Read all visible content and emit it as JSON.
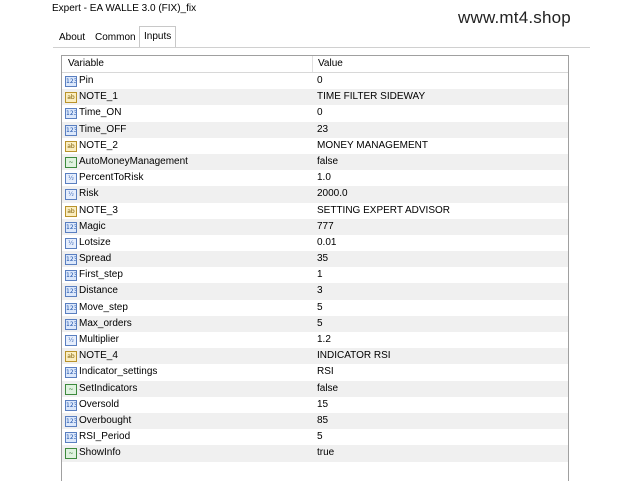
{
  "window": {
    "title": "Expert - EA WALLE 3.0 (FIX)_fix"
  },
  "watermark": "www.mt4.shop",
  "tabs": [
    {
      "label": "About"
    },
    {
      "label": "Common"
    },
    {
      "label": "Inputs",
      "active": true
    }
  ],
  "grid": {
    "headers": {
      "variable": "Variable",
      "value": "Value"
    },
    "rows": [
      {
        "icon": "integer-icon",
        "name": "Pin",
        "value": "0"
      },
      {
        "icon": "string-icon",
        "name": "NOTE_1",
        "value": "TIME FILTER SIDEWAY"
      },
      {
        "icon": "integer-icon",
        "name": "Time_ON",
        "value": "0"
      },
      {
        "icon": "integer-icon",
        "name": "Time_OFF",
        "value": "23"
      },
      {
        "icon": "string-icon",
        "name": "NOTE_2",
        "value": "MONEY MANAGEMENT"
      },
      {
        "icon": "bool-icon",
        "name": "AutoMoneyManagement",
        "value": "false"
      },
      {
        "icon": "double-icon",
        "name": "PercentToRisk",
        "value": "1.0"
      },
      {
        "icon": "double-icon",
        "name": "Risk",
        "value": "2000.0"
      },
      {
        "icon": "string-icon",
        "name": "NOTE_3",
        "value": "SETTING EXPERT ADVISOR"
      },
      {
        "icon": "integer-icon",
        "name": "Magic",
        "value": "777"
      },
      {
        "icon": "double-icon",
        "name": "Lotsize",
        "value": "0.01"
      },
      {
        "icon": "integer-icon",
        "name": "Spread",
        "value": "35"
      },
      {
        "icon": "integer-icon",
        "name": "First_step",
        "value": "1"
      },
      {
        "icon": "integer-icon",
        "name": "Distance",
        "value": "3"
      },
      {
        "icon": "integer-icon",
        "name": "Move_step",
        "value": "5"
      },
      {
        "icon": "integer-icon",
        "name": "Max_orders",
        "value": "5"
      },
      {
        "icon": "double-icon",
        "name": "Multiplier",
        "value": "1.2"
      },
      {
        "icon": "string-icon",
        "name": "NOTE_4",
        "value": "INDICATOR RSI"
      },
      {
        "icon": "integer-icon",
        "name": "Indicator_settings",
        "value": "RSI"
      },
      {
        "icon": "bool-icon",
        "name": "SetIndicators",
        "value": "false"
      },
      {
        "icon": "integer-icon",
        "name": "Oversold",
        "value": "15"
      },
      {
        "icon": "integer-icon",
        "name": "Overbought",
        "value": "85"
      },
      {
        "icon": "integer-icon",
        "name": "RSI_Period",
        "value": "5"
      },
      {
        "icon": "bool-icon",
        "name": "ShowInfo",
        "value": "true"
      }
    ]
  }
}
